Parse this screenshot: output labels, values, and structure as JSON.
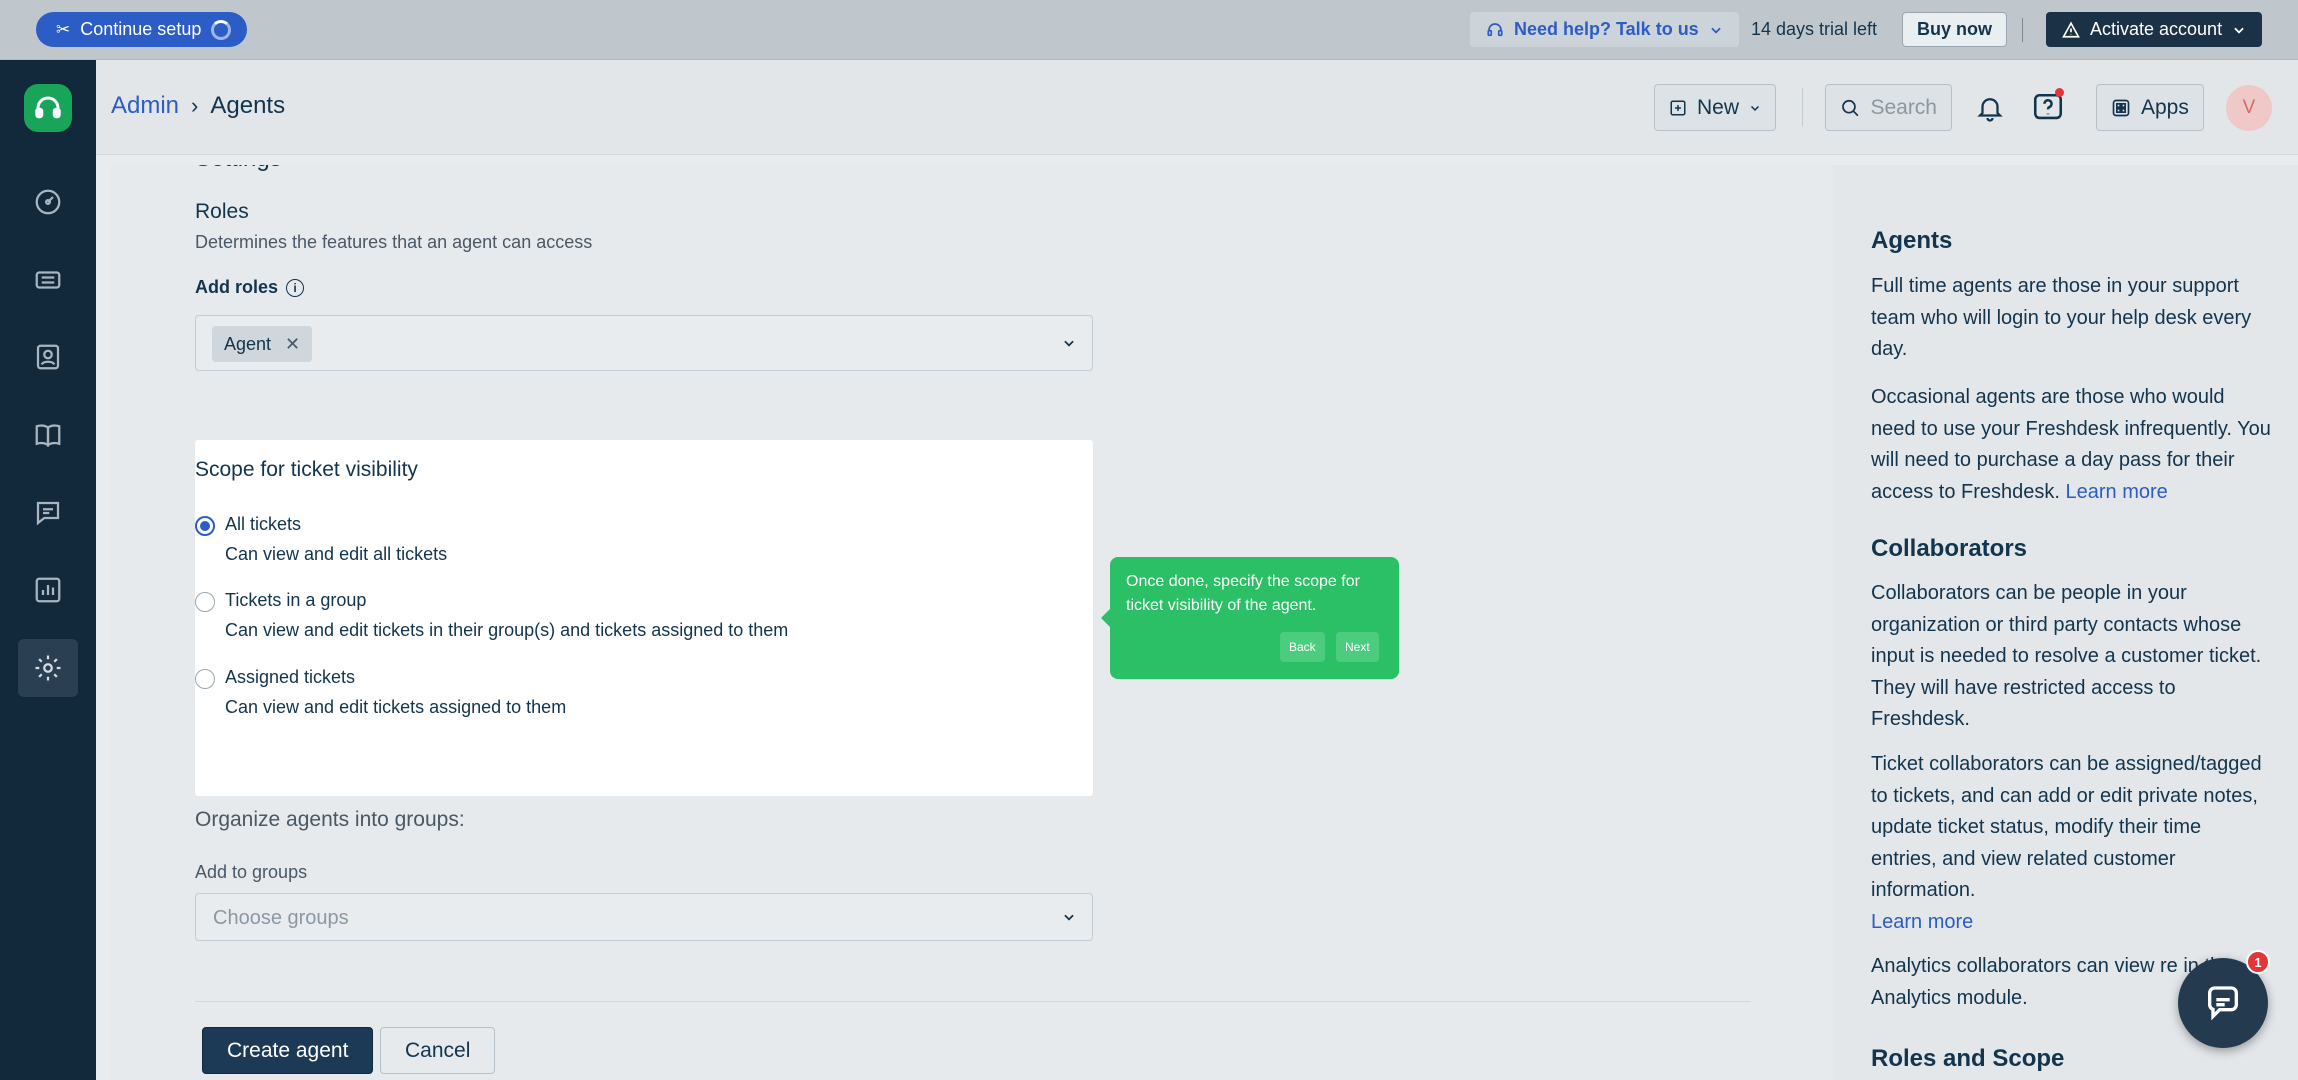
{
  "topbar": {
    "continue_setup": "Continue setup",
    "help": "Need help? Talk to us",
    "trial": "14 days trial left",
    "buy_now": "Buy now",
    "activate": "Activate account"
  },
  "sidebar": {
    "items": [
      {
        "name": "dashboard"
      },
      {
        "name": "tickets"
      },
      {
        "name": "contacts"
      },
      {
        "name": "solutions"
      },
      {
        "name": "discussions"
      },
      {
        "name": "reports"
      },
      {
        "name": "admin",
        "active": true
      }
    ]
  },
  "header": {
    "breadcrumb_root": "Admin",
    "breadcrumb_current": "Agents",
    "new_label": "New",
    "search_placeholder": "Search",
    "apps_label": "Apps",
    "avatar_initial": "V"
  },
  "form": {
    "settings_heading": "Settings",
    "roles_title": "Roles",
    "roles_desc": "Determines the features that an agent can access",
    "add_roles_label": "Add roles",
    "selected_role": "Agent",
    "scope": {
      "title": "Scope for ticket visibility",
      "options": [
        {
          "label": "All tickets",
          "desc": "Can view and edit all tickets",
          "checked": true
        },
        {
          "label": "Tickets in a group",
          "desc": "Can view and edit tickets in their group(s) and tickets assigned to them",
          "checked": false
        },
        {
          "label": "Assigned tickets",
          "desc": "Can view and edit tickets assigned to them",
          "checked": false
        }
      ]
    },
    "groups_title": "Organize agents into groups:",
    "groups_label": "Add to groups",
    "groups_placeholder": "Choose groups",
    "create_label": "Create agent",
    "cancel_label": "Cancel"
  },
  "tour": {
    "text": "Once done, specify the scope for ticket visibility of the agent.",
    "back": "Back",
    "next": "Next"
  },
  "help_panel": {
    "agents_title": "Agents",
    "agents_p1": "Full time agents are those in your support team who will login to your help desk every day.",
    "agents_p2": "Occasional agents are those who would need to use your Freshdesk infrequently. You will need to purchase a day pass for their access to Freshdesk.",
    "learn_more": "Learn more",
    "collab_title": "Collaborators",
    "collab_p1": "Collaborators can be people in your organization or third party contacts whose input is needed to resolve a customer ticket. They will have restricted access to Freshdesk.",
    "collab_p2": "Ticket collaborators can be assigned/tagged to tickets, and can add or edit private notes, update ticket status, modify their time entries, and view related customer information.",
    "collab_p3": "Analytics collaborators can view re in the Analytics module.",
    "roles_title": "Roles and Scope"
  },
  "chat": {
    "badge": "1"
  },
  "colors": {
    "accent": "#2c5cc5",
    "tour": "#2bc065",
    "sidebar": "#12293c"
  }
}
